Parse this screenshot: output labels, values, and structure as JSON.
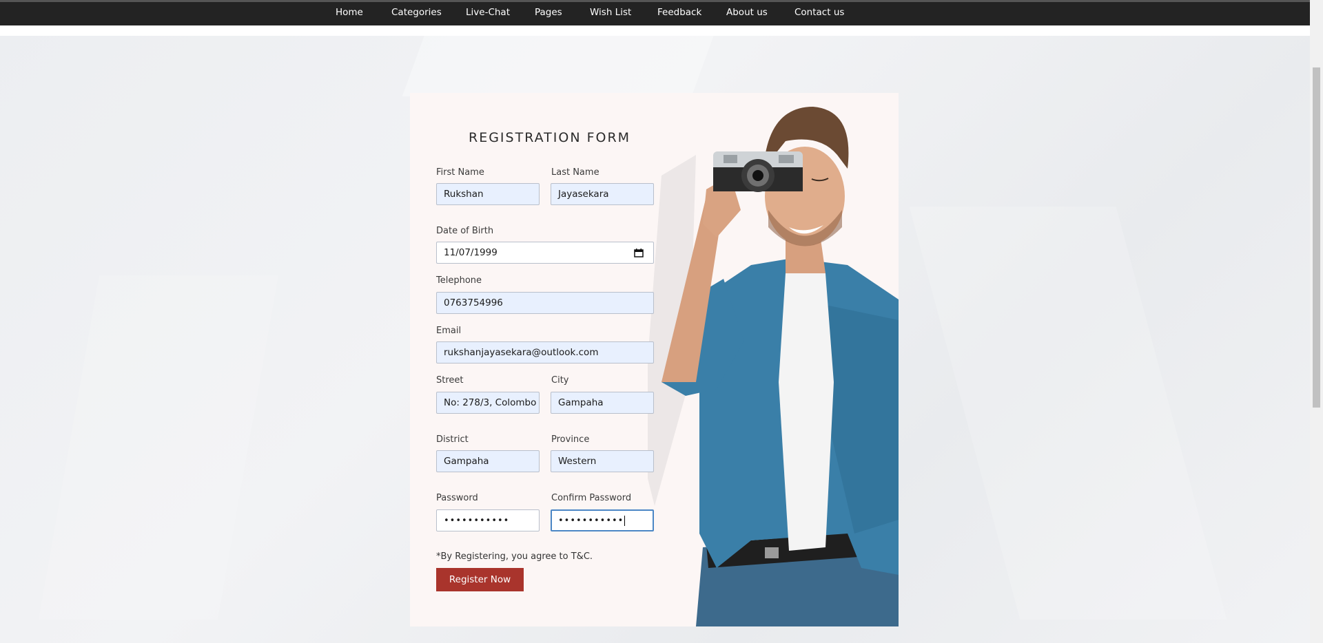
{
  "nav": {
    "items": [
      "Home",
      "Categories",
      "Live-Chat",
      "Pages",
      "Wish List",
      "Feedback",
      "About us",
      "Contact us"
    ]
  },
  "form": {
    "title": "REGISTRATION FORM",
    "first_name": {
      "label": "First Name",
      "value": "Rukshan"
    },
    "last_name": {
      "label": "Last Name",
      "value": "Jayasekara"
    },
    "dob": {
      "label": "Date of Birth",
      "value": "11/07/1999"
    },
    "telephone": {
      "label": "Telephone",
      "value": "0763754996"
    },
    "email": {
      "label": "Email",
      "value": "rukshanjayasekara@outlook.com"
    },
    "street": {
      "label": "Street",
      "value": "No: 278/3, Colombo"
    },
    "city": {
      "label": "City",
      "value": "Gampaha"
    },
    "district": {
      "label": "District",
      "value": "Gampaha"
    },
    "province": {
      "label": "Province",
      "value": "Western"
    },
    "password": {
      "label": "Password",
      "value": "•••••••••••"
    },
    "confirm_password": {
      "label": "Confirm Password",
      "value": "•••••••••••"
    },
    "terms_note": "*By Registering, you agree to T&C.",
    "submit_label": "Register Now"
  },
  "icons": {
    "date_picker": "calendar-icon"
  },
  "colors": {
    "navbar": "#232323",
    "card": "#fcf6f5",
    "autofill": "#e8f0fe",
    "button": "#a9342c",
    "focus": "#4a86c5",
    "shirt": "#3a7fa8"
  }
}
